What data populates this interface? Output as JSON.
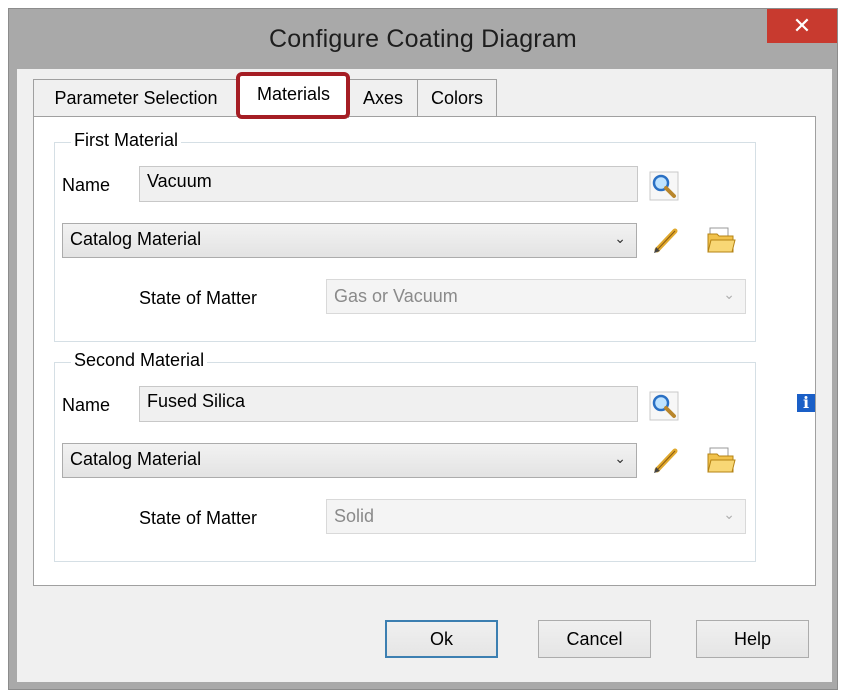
{
  "dialog": {
    "title": "Configure Coating Diagram",
    "close_label": "✕"
  },
  "tabs": [
    {
      "label": "Parameter Selection",
      "active": false
    },
    {
      "label": "Materials",
      "active": true
    },
    {
      "label": "Axes",
      "active": false
    },
    {
      "label": "Colors",
      "active": false
    }
  ],
  "first_material": {
    "group_title": "First Material",
    "name_label": "Name",
    "name_value": "Vacuum",
    "source_select": "Catalog Material",
    "state_label": "State of Matter",
    "state_value": "Gas or Vacuum"
  },
  "second_material": {
    "group_title": "Second Material",
    "name_label": "Name",
    "name_value": "Fused Silica",
    "source_select": "Catalog Material",
    "state_label": "State of Matter",
    "state_value": "Solid"
  },
  "info_glyph": "i",
  "buttons": {
    "ok": "Ok",
    "cancel": "Cancel",
    "help": "Help"
  },
  "icons": {
    "search": "magnifier-icon",
    "edit": "pencil-icon",
    "open": "open-folder-icon",
    "info": "info-icon"
  },
  "colors": {
    "highlight": "#a51d24",
    "close_button": "#c83a2f",
    "info": "#1a5fc7"
  }
}
